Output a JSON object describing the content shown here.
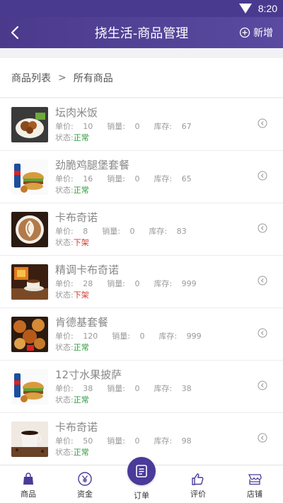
{
  "status_bar": {
    "time": "8:20"
  },
  "header": {
    "title": "挠生活-商品管理",
    "add_label": "新增"
  },
  "breadcrumb": {
    "root": "商品列表",
    "separator": ">",
    "current": "所有商品"
  },
  "labels": {
    "price": "单价:",
    "sales": "销量:",
    "stock": "库存:",
    "status": "状态:"
  },
  "products": [
    {
      "name": "坛肉米饭",
      "price": "10",
      "sales": "0",
      "stock": "67",
      "status": "正常",
      "status_type": "on",
      "thumb": "rice-bowl"
    },
    {
      "name": "劲脆鸡腿堡套餐",
      "price": "16",
      "sales": "0",
      "stock": "65",
      "status": "正常",
      "status_type": "on",
      "thumb": "burger-combo"
    },
    {
      "name": "卡布奇诺",
      "price": "8",
      "sales": "0",
      "stock": "83",
      "status": "下架",
      "status_type": "off",
      "thumb": "latte-art"
    },
    {
      "name": "精调卡布奇诺",
      "price": "28",
      "sales": "0",
      "stock": "999",
      "status": "下架",
      "status_type": "off",
      "thumb": "coffee-fireplace"
    },
    {
      "name": "肯德基套餐",
      "price": "120",
      "sales": "0",
      "stock": "999",
      "status": "正常",
      "status_type": "on",
      "thumb": "kfc-bucket"
    },
    {
      "name": "12寸水果披萨",
      "price": "38",
      "sales": "0",
      "stock": "38",
      "status": "正常",
      "status_type": "on",
      "thumb": "burger-combo"
    },
    {
      "name": "卡布奇诺",
      "price": "50",
      "sales": "0",
      "stock": "98",
      "status": "正常",
      "status_type": "on",
      "thumb": "coffee-cup"
    }
  ],
  "tabbar": {
    "items": [
      {
        "label": "商品",
        "icon": "bag-icon"
      },
      {
        "label": "资金",
        "icon": "yen-icon"
      },
      {
        "label": "订单",
        "icon": "orders-icon"
      },
      {
        "label": "评价",
        "icon": "thumbs-up-icon"
      },
      {
        "label": "店铺",
        "icon": "store-icon"
      }
    ]
  },
  "colors": {
    "primary": "#4b3a8c",
    "status_on": "#2e9a3c",
    "status_off": "#d33a2c",
    "accent_tab": "#4a3a9a"
  }
}
